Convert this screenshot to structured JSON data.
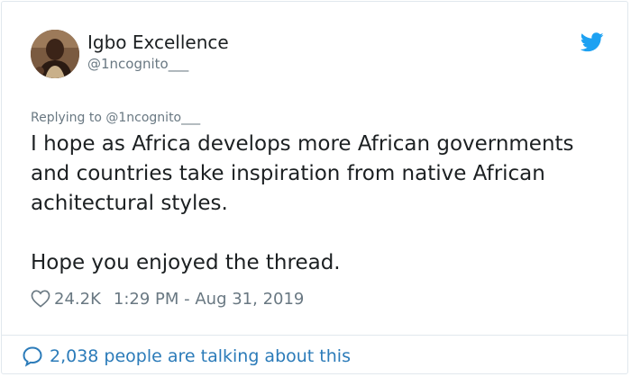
{
  "author": {
    "name": "Igbo Excellence",
    "handle": "@1ncognito___"
  },
  "reply": {
    "text": "Replying to @1ncognito___"
  },
  "tweet": {
    "text": "I hope as Africa develops more African governments and countries take inspiration from native African achitectural styles.\n\nHope you enjoyed the thread."
  },
  "meta": {
    "likes": "24.2K",
    "timestamp": "1:29 PM - Aug 31, 2019"
  },
  "footer": {
    "conversation": "2,038 people are talking about this"
  },
  "icons": {
    "brand": "twitter-bird-icon",
    "like": "heart-icon",
    "reply": "speech-bubble-icon"
  },
  "colors": {
    "brand": "#1da1f2",
    "link": "#2b7bb9",
    "muted": "#697882",
    "text": "#1c2022"
  }
}
